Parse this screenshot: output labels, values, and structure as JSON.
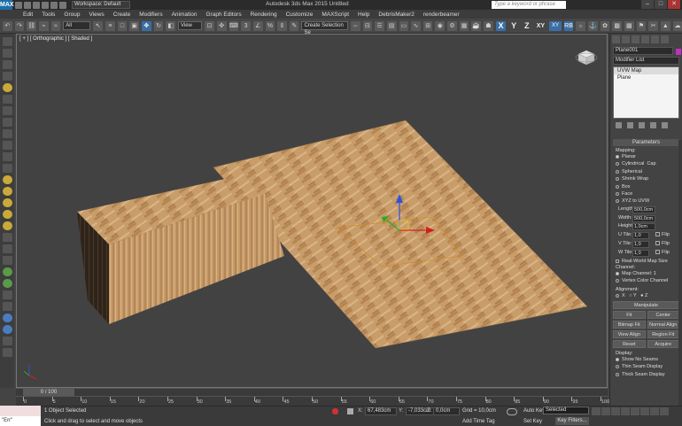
{
  "title": {
    "logo": "MAX",
    "workspace": "Workspace: Default",
    "app_title": "Autodesk 3ds Max 2015     Untitled",
    "search_placeholder": "Type a keyword or phrase",
    "min": "–",
    "max": "□",
    "close": "✕"
  },
  "menu": [
    "Edit",
    "Tools",
    "Group",
    "Views",
    "Create",
    "Modifiers",
    "Animation",
    "Graph Editors",
    "Rendering",
    "Customize",
    "MAXScript",
    "Help",
    "DebrisMaker2",
    "renderbeamer"
  ],
  "toolbar": {
    "filter": "All",
    "refcoord": "View",
    "named_sel": "Create Selection Se",
    "axis_x": "X",
    "axis_y": "Y",
    "axis_z": "Z",
    "axis_xy": "XY",
    "axis_xy2": "XY"
  },
  "viewport": {
    "label": "[ + ] [ Orthographic ] [ Shaded ]"
  },
  "timeline": {
    "slider": "0 / 100"
  },
  "ruler": [
    0,
    5,
    10,
    15,
    20,
    25,
    30,
    35,
    40,
    45,
    50,
    55,
    60,
    65,
    70,
    75,
    80,
    85,
    90,
    95,
    100
  ],
  "status": {
    "maxscript": "",
    "maxscript_err": "\"Err\"",
    "selected": "1 Object Selected",
    "prompt": "Click and drag to select and move objects",
    "x_label": "X:",
    "x_value": "67,483cm",
    "y_label": "Y:",
    "y_value": "-7,033cm",
    "z_label": "Z:",
    "z_value": "0,0cm",
    "grid": "Grid = 10,0cm",
    "add_time_tag": "Add Time Tag",
    "auto_key": "Auto Key",
    "set_key": "Set Key",
    "selected_dd": "Selected",
    "key_filters": "Key Filters..."
  },
  "panel": {
    "object_name": "Plane001",
    "modifier_list": "Modifier List",
    "stack": [
      "UVW Map",
      "Plane"
    ],
    "params_title": "Parameters",
    "mapping_label": "Mapping:",
    "mapping": [
      "Planar",
      "Cylindrical",
      "Spherical",
      "Shrink Wrap",
      "Box",
      "Face",
      "XYZ to UVW"
    ],
    "cap": "Cap",
    "length_label": "Length:",
    "length": "500,0cm",
    "width_label": "Width:",
    "width": "500,0cm",
    "height_label": "Height:",
    "height": "1,0cm",
    "utile_label": "U Tile:",
    "utile": "1,0",
    "vtile_label": "V Tile:",
    "vtile": "1,0",
    "wtile_label": "W Tile:",
    "wtile": "1,0",
    "flip": "Flip",
    "real_world": "Real-World Map Size",
    "channel_label": "Channel:",
    "map_channel": "Map Channel:",
    "map_channel_val": "1",
    "vertex_color": "Vertex Color Channel",
    "alignment_label": "Alignment:",
    "ax": "X",
    "ay": "Y",
    "az": "Z",
    "manipulate": "Manipulate",
    "fit": "Fit",
    "center": "Center",
    "bitmap_fit": "Bitmap Fit",
    "normal_align": "Normal Align",
    "view_align": "View Align",
    "region_fit": "Region Fit",
    "reset": "Reset",
    "acquire": "Acquire",
    "display_label": "Display:",
    "show_no_seams": "Show No Seams",
    "thin_seam": "Thin Seam Display",
    "thick_seam": "Thick Seam Display"
  }
}
